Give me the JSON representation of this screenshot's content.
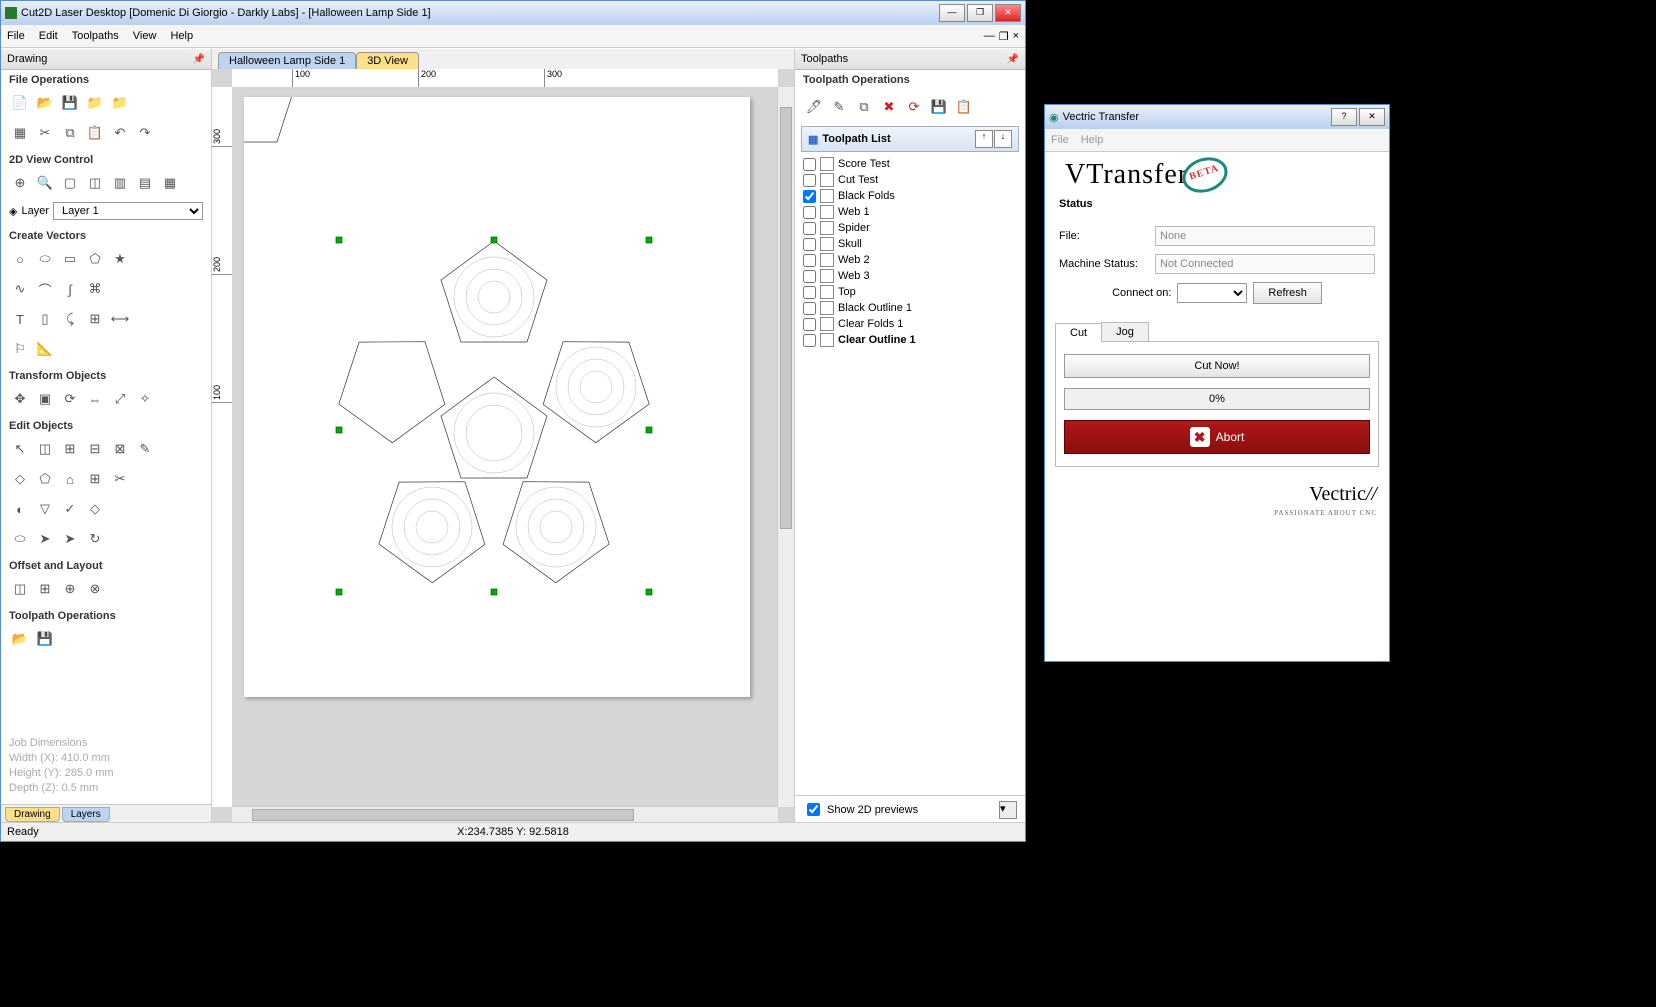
{
  "main": {
    "title": "Cut2D Laser Desktop [Domenic Di Giorgio - Darkly Labs] - [Halloween Lamp Side 1]",
    "menu": [
      "File",
      "Edit",
      "Toolpaths",
      "View",
      "Help"
    ],
    "mdi": {
      "min": "—",
      "max": "❐",
      "close": "×"
    },
    "drawing_panel": "Drawing",
    "sections": {
      "file_ops": "File Operations",
      "view2d": "2D View Control",
      "create_vec": "Create Vectors",
      "transform": "Transform Objects",
      "edit": "Edit Objects",
      "offset": "Offset and Layout",
      "tp_ops": "Toolpath Operations"
    },
    "layer_label": "Layer",
    "layer_value": "Layer 1",
    "job_dim_title": "Job Dimensions",
    "job_w": "Width  (X): 410.0 mm",
    "job_h": "Height (Y): 285.0 mm",
    "job_d": "Depth  (Z): 0.5 mm",
    "draw_tab": "Drawing",
    "layers_tab": "Layers",
    "doc_tab": "Halloween Lamp Side 1",
    "d3_tab": "3D View",
    "ruler": {
      "h": [
        "100",
        "200",
        "300"
      ],
      "v": [
        "300",
        "200",
        "100"
      ]
    },
    "status_ready": "Ready",
    "status_coords": "X:234.7385 Y: 92.5818"
  },
  "tp": {
    "panel": "Toolpaths",
    "ops": "Toolpath Operations",
    "list": "Toolpath List",
    "items": [
      {
        "label": "Score Test",
        "checked": false,
        "bold": false
      },
      {
        "label": "Cut Test",
        "checked": false,
        "bold": false
      },
      {
        "label": "Black Folds",
        "checked": true,
        "bold": false
      },
      {
        "label": "Web 1",
        "checked": false,
        "bold": false
      },
      {
        "label": "Spider",
        "checked": false,
        "bold": false
      },
      {
        "label": "Skull",
        "checked": false,
        "bold": false
      },
      {
        "label": "Web 2",
        "checked": false,
        "bold": false
      },
      {
        "label": "Web 3",
        "checked": false,
        "bold": false
      },
      {
        "label": "Top",
        "checked": false,
        "bold": false
      },
      {
        "label": "Black Outline 1",
        "checked": false,
        "bold": false
      },
      {
        "label": "Clear Folds 1",
        "checked": false,
        "bold": false
      },
      {
        "label": "Clear Outline 1",
        "checked": false,
        "bold": true
      }
    ],
    "show2d": "Show 2D previews"
  },
  "vt": {
    "title": "Vectric Transfer",
    "menu": [
      "File",
      "Help"
    ],
    "logo": "VTransfer",
    "beta": "BETA",
    "status_label": "Status",
    "file_label": "File:",
    "file_value": "None",
    "machine_label": "Machine Status:",
    "machine_value": "Not Connected",
    "connect_label": "Connect on:",
    "refresh": "Refresh",
    "tab_cut": "Cut",
    "tab_jog": "Jog",
    "cut_now": "Cut Now!",
    "progress": "0%",
    "abort": "Abort",
    "footer_big": "Vectric",
    "footer_sm": "PASSIONATE ABOUT CNC"
  }
}
